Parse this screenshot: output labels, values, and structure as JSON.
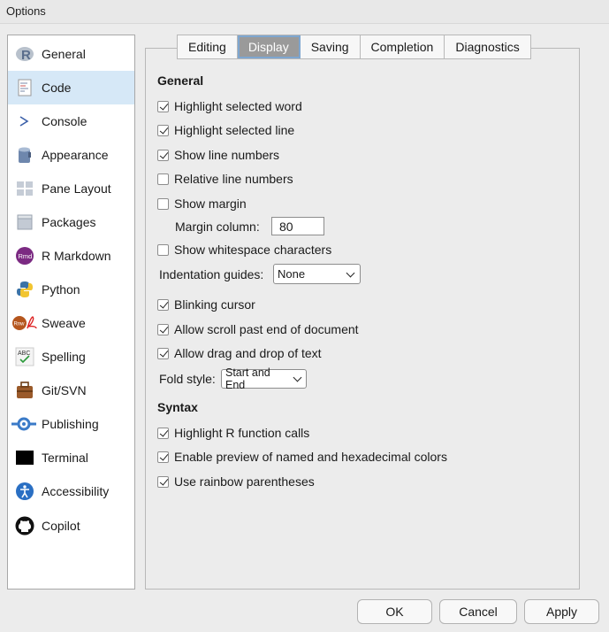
{
  "window": {
    "title": "Options"
  },
  "sidebar": {
    "items": [
      {
        "label": "General",
        "icon": "r-logo-icon"
      },
      {
        "label": "Code",
        "icon": "code-file-icon",
        "selected": true
      },
      {
        "label": "Console",
        "icon": "console-prompt-icon"
      },
      {
        "label": "Appearance",
        "icon": "paint-bucket-icon"
      },
      {
        "label": "Pane Layout",
        "icon": "pane-layout-icon"
      },
      {
        "label": "Packages",
        "icon": "packages-icon"
      },
      {
        "label": "R Markdown",
        "icon": "rmd-icon"
      },
      {
        "label": "Python",
        "icon": "python-icon"
      },
      {
        "label": "Sweave",
        "icon": "sweave-icon"
      },
      {
        "label": "Spelling",
        "icon": "spelling-abc-icon"
      },
      {
        "label": "Git/SVN",
        "icon": "git-briefcase-icon"
      },
      {
        "label": "Publishing",
        "icon": "publishing-icon"
      },
      {
        "label": "Terminal",
        "icon": "terminal-icon"
      },
      {
        "label": "Accessibility",
        "icon": "accessibility-icon"
      },
      {
        "label": "Copilot",
        "icon": "github-copilot-icon"
      }
    ]
  },
  "tabs": [
    {
      "label": "Editing"
    },
    {
      "label": "Display",
      "active": true
    },
    {
      "label": "Saving"
    },
    {
      "label": "Completion"
    },
    {
      "label": "Diagnostics"
    }
  ],
  "general": {
    "heading": "General",
    "highlight_word": {
      "label": "Highlight selected word",
      "checked": true
    },
    "highlight_line": {
      "label": "Highlight selected line",
      "checked": true
    },
    "line_numbers": {
      "label": "Show line numbers",
      "checked": true
    },
    "relative_numbers": {
      "label": "Relative line numbers",
      "checked": false
    },
    "show_margin": {
      "label": "Show margin",
      "checked": false
    },
    "margin_column_label": "Margin column:",
    "margin_column_value": "80",
    "whitespace": {
      "label": "Show whitespace characters",
      "checked": false
    },
    "indentation_label": "Indentation guides:",
    "indentation_value": "None",
    "blinking_cursor": {
      "label": "Blinking cursor",
      "checked": true
    },
    "scroll_past": {
      "label": "Allow scroll past end of document",
      "checked": true
    },
    "drag_drop": {
      "label": "Allow drag and drop of text",
      "checked": true
    },
    "fold_label": "Fold style:",
    "fold_value": "Start and End"
  },
  "syntax": {
    "heading": "Syntax",
    "highlight_r": {
      "label": "Highlight R function calls",
      "checked": true
    },
    "preview_colors": {
      "label": "Enable preview of named and hexadecimal colors",
      "checked": true
    },
    "rainbow": {
      "label": "Use rainbow parentheses",
      "checked": true
    }
  },
  "buttons": {
    "ok": "OK",
    "cancel": "Cancel",
    "apply": "Apply"
  },
  "colors": {
    "selected_bg": "#d6e8f7",
    "active_tab": "#9a9a9a",
    "focus_ring": "#7ea6d0"
  }
}
